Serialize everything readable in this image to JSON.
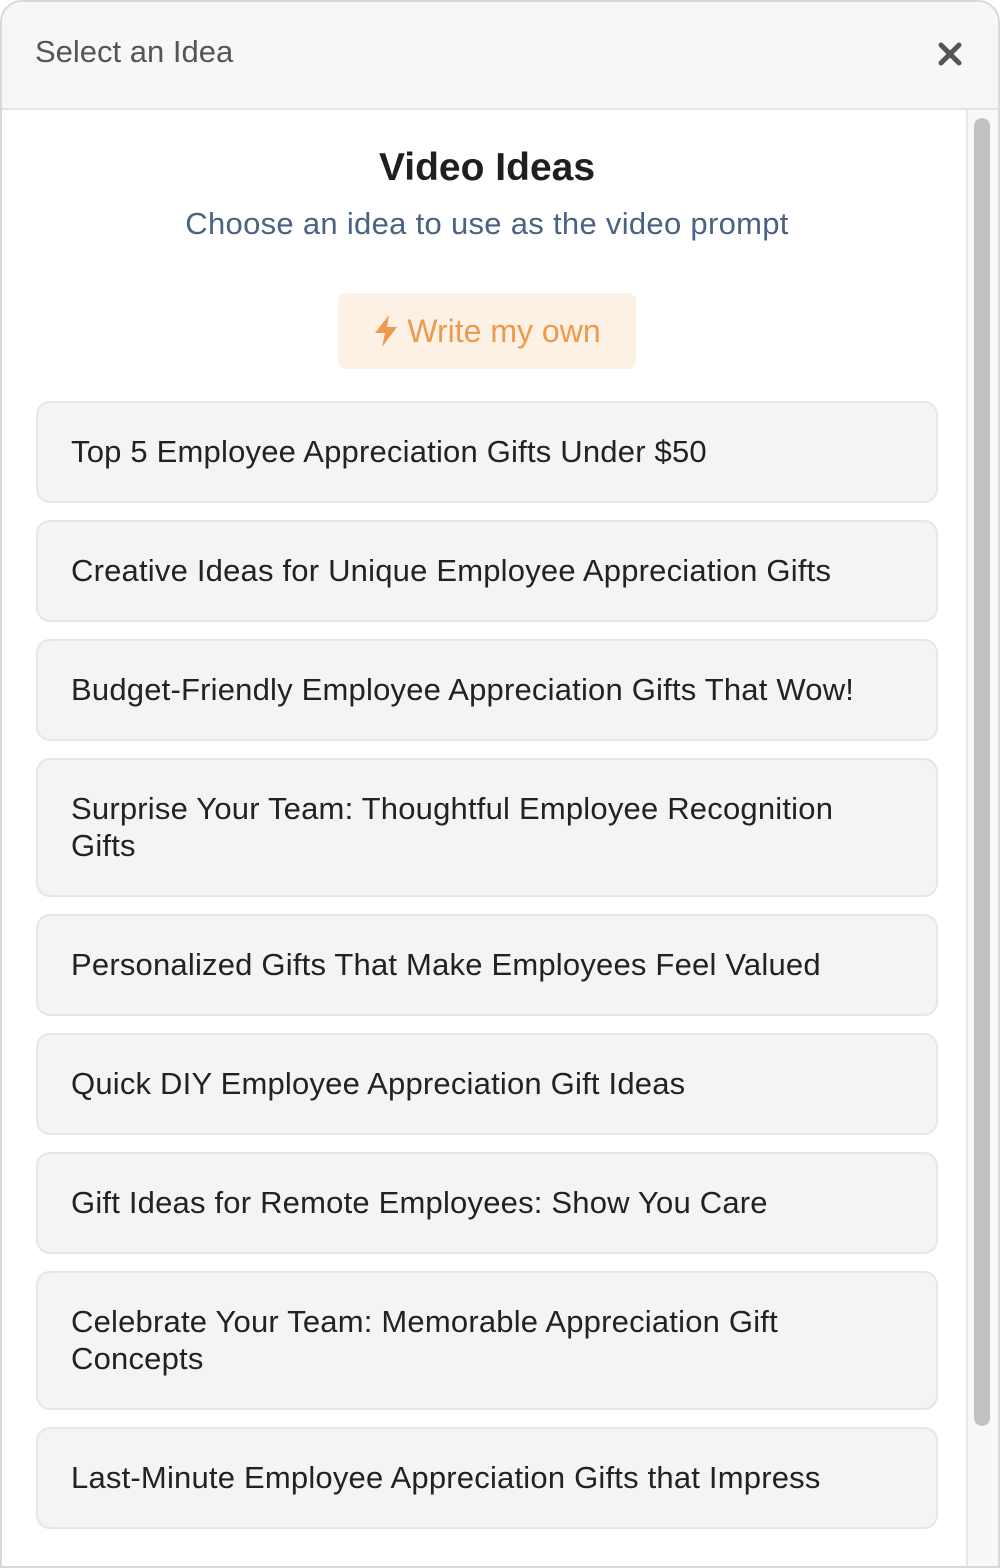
{
  "dialog": {
    "title": "Select an Idea",
    "close_icon": "close-icon"
  },
  "main": {
    "heading": "Video Ideas",
    "subheading": "Choose an idea to use as the video prompt",
    "write_button": {
      "label": "Write my own",
      "icon": "bolt-icon",
      "color": "#ee9a4c",
      "background": "#fdf0e4"
    },
    "ideas": [
      "Top 5 Employee Appreciation Gifts Under $50",
      "Creative Ideas for Unique Employee Appreciation Gifts",
      "Budget-Friendly Employee Appreciation Gifts That Wow!",
      "Surprise Your Team: Thoughtful Employee Recognition Gifts",
      "Personalized Gifts That Make Employees Feel Valued",
      "Quick DIY Employee Appreciation Gift Ideas",
      "Gift Ideas for Remote Employees: Show You Care",
      "Celebrate Your Team: Memorable Appreciation Gift Concepts",
      "Last-Minute Employee Appreciation Gifts that Impress"
    ]
  }
}
